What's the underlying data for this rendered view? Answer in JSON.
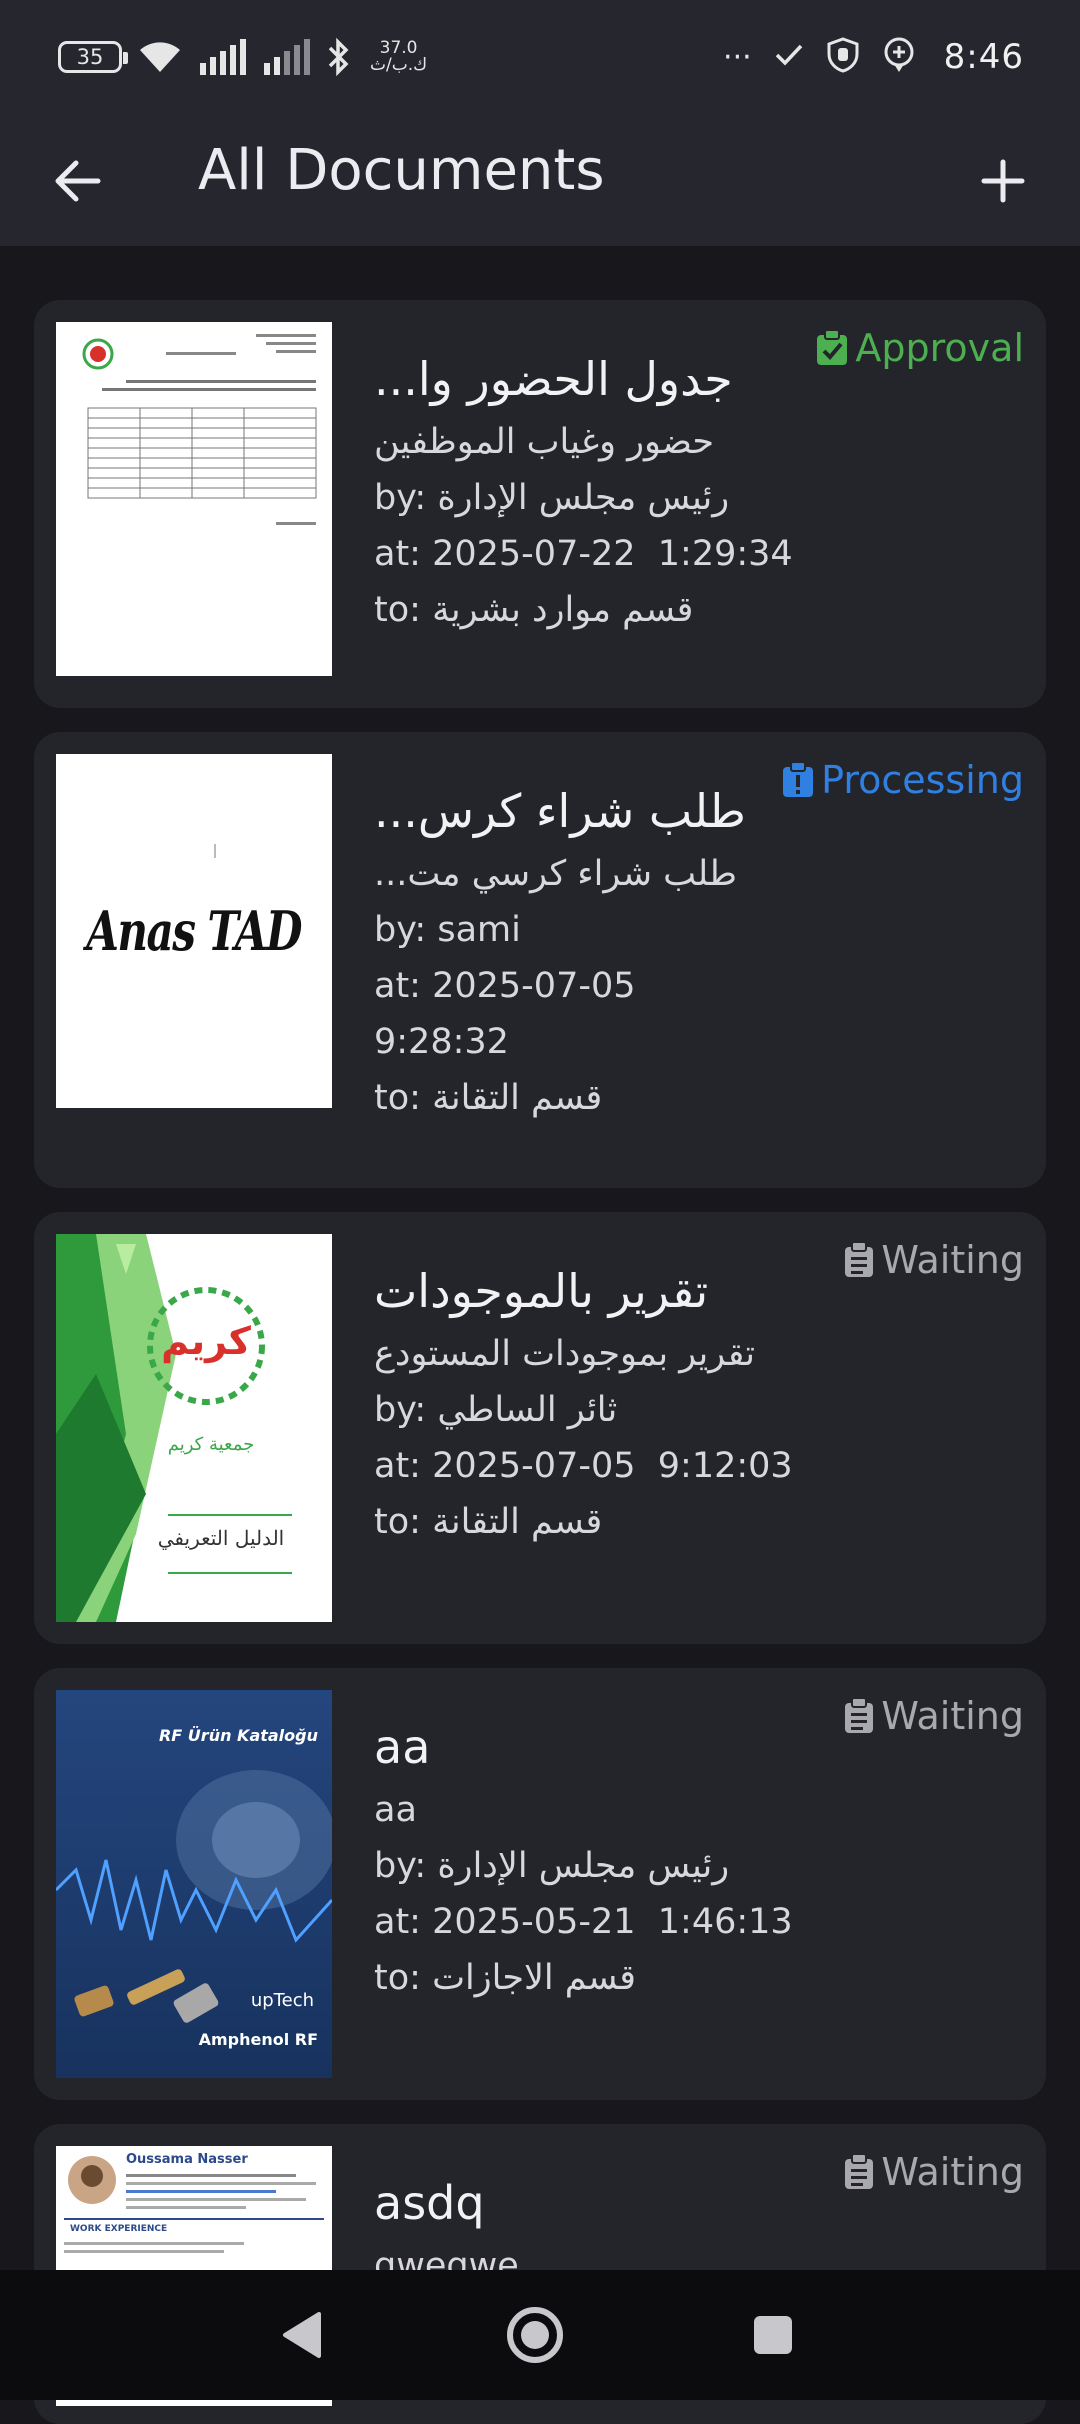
{
  "status_bar": {
    "battery": "35",
    "net_speed_value": "37.0",
    "net_speed_unit": "ك.ب/ث",
    "more_dots": "···",
    "time": "8:46"
  },
  "app_bar": {
    "title": "All Documents"
  },
  "documents": [
    {
      "title": "...جدول الحضور وا",
      "subtitle": "حضور وغياب الموظفين",
      "by_label": "by:",
      "by": "رئيس مجلس الإدارة",
      "at_label": "at:",
      "at": "2025-07-22  1:29:34",
      "to_label": "to:",
      "to": "قسم موارد بشرية",
      "status": "Approval",
      "status_color": "#4caf50",
      "status_icon": "clipboard-check-icon"
    },
    {
      "title": "...طلب شراء كرس",
      "subtitle": "...طلب شراء كرسي مت",
      "by_label": "by:",
      "by": "sami",
      "at_label": "at:",
      "at_date": "2025-07-05",
      "at_time": "9:28:32",
      "to_label": "to:",
      "to": "قسم التقانة",
      "status": "Processing",
      "status_color": "#2f80e0",
      "status_icon": "clipboard-alert-icon",
      "thumb_text": "Anas TAD"
    },
    {
      "title": "تقرير بالموجودات",
      "subtitle": "تقرير بموجودات المستودع",
      "by_label": "by:",
      "by": "ثائر الساطي",
      "at_label": "at:",
      "at": "2025-07-05  9:12:03",
      "to_label": "to:",
      "to": "قسم التقانة",
      "status": "Waiting",
      "status_color": "#a8a8ae",
      "status_icon": "clipboard-text-icon",
      "thumb_text": "كريم",
      "thumb_sub": "جمعية كريم",
      "thumb_foot": "الدليل التعريفي"
    },
    {
      "title": "aa",
      "subtitle": "aa",
      "by_label": "by:",
      "by": "رئيس مجلس الإدارة",
      "at_label": "at:",
      "at": "2025-05-21  1:46:13",
      "to_label": "to:",
      "to": "قسم الاجازات",
      "status": "Waiting",
      "status_color": "#a8a8ae",
      "status_icon": "clipboard-text-icon",
      "thumb_text": "RF Ürün Kataloğu",
      "thumb_brand1": "upTech",
      "thumb_brand2": "Amphenol RF"
    },
    {
      "title": "asdq",
      "subtitle": "qweqwe",
      "status": "Waiting",
      "status_color": "#a8a8ae",
      "status_icon": "clipboard-text-icon",
      "thumb_name": "Oussama Nasser",
      "thumb_section": "WORK EXPERIENCE"
    }
  ]
}
